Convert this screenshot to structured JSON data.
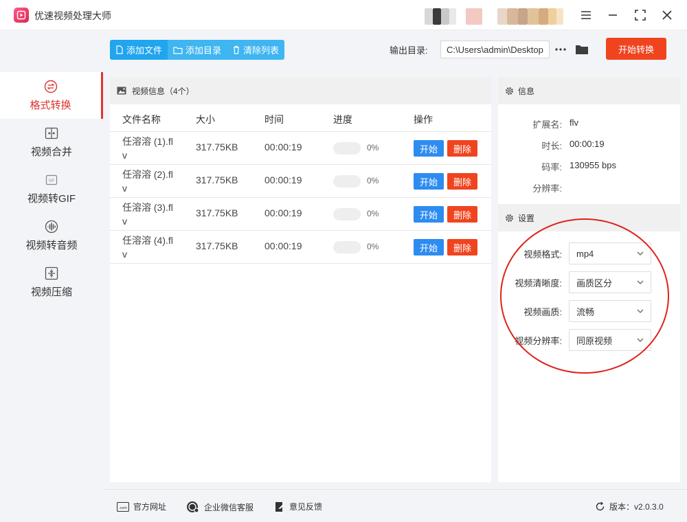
{
  "app": {
    "title": "优速视频处理大师"
  },
  "sidebar": {
    "items": [
      {
        "label": "格式转换",
        "icon": "format-convert-icon",
        "active": true
      },
      {
        "label": "视频合并",
        "icon": "video-merge-icon",
        "active": false
      },
      {
        "label": "视频转GIF",
        "icon": "video-gif-icon",
        "active": false
      },
      {
        "label": "视频转音频",
        "icon": "video-audio-icon",
        "active": false
      },
      {
        "label": "视频压缩",
        "icon": "video-compress-icon",
        "active": false
      }
    ]
  },
  "toolbar": {
    "add_file": "添加文件",
    "add_dir": "添加目录",
    "clear_list": "清除列表",
    "output_label": "输出目录:",
    "output_path": "C:\\Users\\admin\\Desktop",
    "start_convert": "开始转换"
  },
  "file_panel": {
    "header": "视频信息（4个）",
    "columns": {
      "name": "文件名称",
      "size": "大小",
      "time": "时间",
      "progress": "进度",
      "action": "操作"
    },
    "rows": [
      {
        "name": "任溶溶 (1).flv",
        "size": "317.75KB",
        "time": "00:00:19",
        "progress": "0%",
        "start": "开始",
        "delete": "删除"
      },
      {
        "name": "任溶溶 (2).flv",
        "size": "317.75KB",
        "time": "00:00:19",
        "progress": "0%",
        "start": "开始",
        "delete": "删除"
      },
      {
        "name": "任溶溶 (3).flv",
        "size": "317.75KB",
        "time": "00:00:19",
        "progress": "0%",
        "start": "开始",
        "delete": "删除"
      },
      {
        "name": "任溶溶 (4).flv",
        "size": "317.75KB",
        "time": "00:00:19",
        "progress": "0%",
        "start": "开始",
        "delete": "删除"
      }
    ]
  },
  "info_panel": {
    "header": "信息",
    "ext_label": "扩展名:",
    "ext_value": "flv",
    "duration_label": "时长:",
    "duration_value": "00:00:19",
    "bitrate_label": "码率:",
    "bitrate_value": "130955 bps",
    "resolution_label": "分辨率:",
    "resolution_value": ""
  },
  "settings_panel": {
    "header": "设置",
    "format_label": "视频格式:",
    "format_value": "mp4",
    "clarity_label": "视频清晰度:",
    "clarity_value": "画质区分",
    "quality_label": "视频画质:",
    "quality_value": "流畅",
    "resolution_label": "视频分辨率:",
    "resolution_value": "同原视频"
  },
  "footer": {
    "website": "官方网址",
    "wechat": "企业微信客服",
    "feedback": "意见反馈",
    "version": "版本：v2.0.3.0"
  },
  "colors": {
    "accent_red": "#f0441f",
    "accent_blue": "#2d8cf0",
    "toolbar_blue": "#3fb5f1",
    "active_red": "#e0322d",
    "annotation_red": "#e0211b"
  }
}
